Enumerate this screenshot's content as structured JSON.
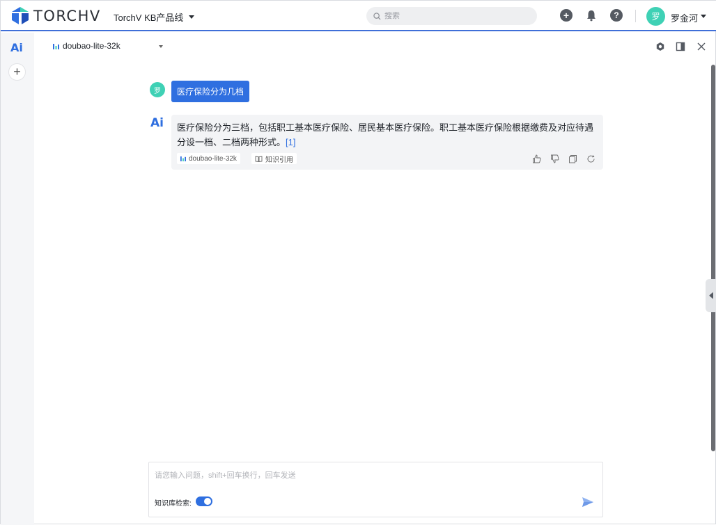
{
  "header": {
    "brand": "TORCHV",
    "kb_selector": "TorchV KB产品线",
    "search_placeholder": "搜索",
    "user_avatar_text": "罗",
    "user_name": "罗金河"
  },
  "model": {
    "name": "doubao-lite-32k"
  },
  "conversation": {
    "user": {
      "avatar_text": "罗",
      "message": "医疗保险分为几档"
    },
    "assistant": {
      "mark": "Ai",
      "text": "医疗保险分为三档，包括职工基本医疗保险、居民基本医疗保险。职工基本医疗保险根据缴费及对应待遇分设一档、二档两种形式。",
      "reference": "[1]",
      "model_tag": "doubao-lite-32k",
      "knowledge_tag": "知识引用"
    }
  },
  "composer": {
    "placeholder": "请您输入问题，shift+回车换行，回车发送",
    "kb_search_label": "知识库检索:",
    "kb_search_enabled": true
  },
  "colors": {
    "accent": "#2f6fe0",
    "avatar": "#3fd1b5",
    "header_border": "#3f6fd8"
  },
  "icons": [
    "torchv-logo-icon",
    "search-icon",
    "plus-circle-icon",
    "bell-icon",
    "help-icon",
    "chevron-down-icon",
    "ai-icon",
    "plus-icon",
    "model-bars-icon",
    "settings-icon",
    "sidebar-panel-icon",
    "close-icon",
    "book-icon",
    "thumbs-up-icon",
    "thumbs-down-icon",
    "copy-icon",
    "refresh-icon",
    "send-icon",
    "collapse-left-icon"
  ]
}
